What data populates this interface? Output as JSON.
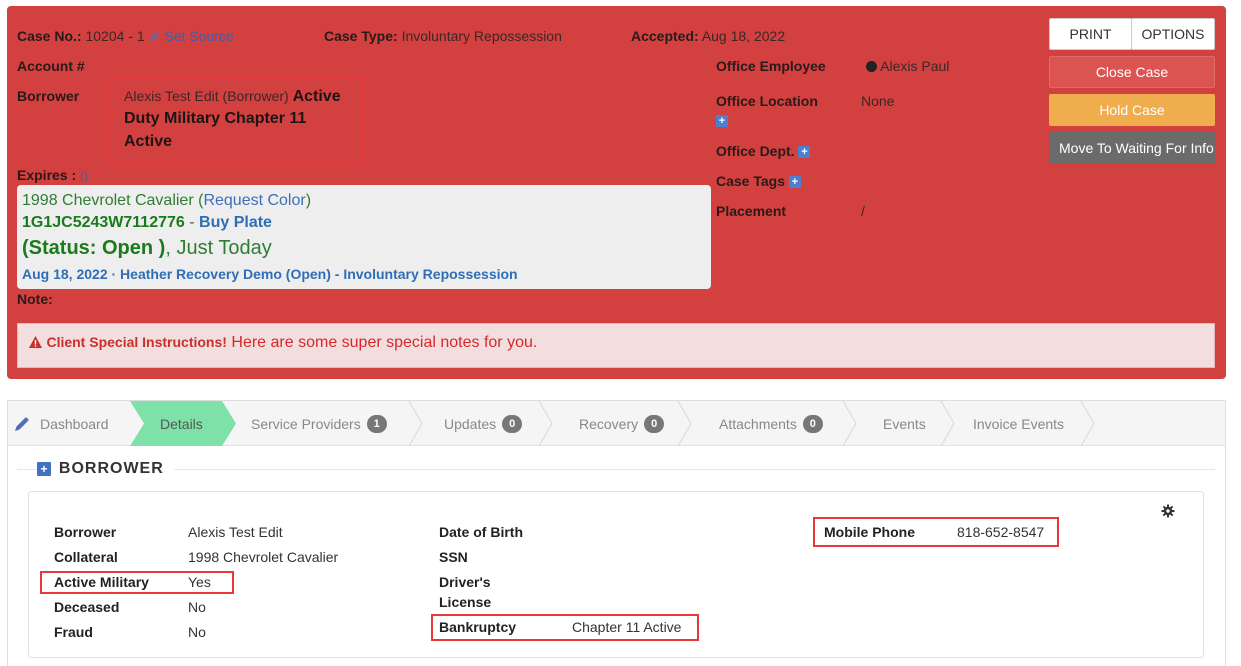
{
  "header": {
    "case_no_label": "Case No.:",
    "case_no_value": "10204 - 1",
    "set_source": "Set Source",
    "case_type_label": "Case Type:",
    "case_type_value": "Involuntary Repossession",
    "accepted_label": "Accepted:",
    "accepted_value": "Aug 18, 2022",
    "account_label": "Account #",
    "borrower_label": "Borrower",
    "borrower_name": "Alexis Test Edit (Borrower)",
    "borrower_status_1": "Active",
    "borrower_status_2": "Duty Military Chapter 11",
    "borrower_status_3": "Active",
    "expires_label": "Expires :",
    "expires_value": "()",
    "note_label": "Note:",
    "office_employee_label": "Office Employee",
    "office_employee_value": "Alexis Paul",
    "office_location_label": "Office Location",
    "office_location_value": "None",
    "office_dept_label": "Office Dept.",
    "case_tags_label": "Case Tags",
    "placement_label": "Placement",
    "placement_value": "/"
  },
  "vehicle": {
    "name": "1998 Chevrolet Cavalier",
    "request_color": "Request Color",
    "vin": "1G1JC5243W7112776",
    "buy_plate": "Buy Plate",
    "status": "(Status: Open )",
    "status_when": ", Just Today",
    "history": "Aug 18, 2022 · Heather Recovery Demo (Open) - Involuntary Repossession"
  },
  "special": {
    "label": "Client Special Instructions!",
    "text": "Here are some super special notes for you."
  },
  "buttons": {
    "print": "PRINT",
    "options": "OPTIONS",
    "close_case": "Close Case",
    "hold_case": "Hold Case",
    "waiting": "Move To Waiting For Info"
  },
  "tabs": [
    {
      "label": "Dashboard"
    },
    {
      "label": "Details"
    },
    {
      "label": "Service Providers",
      "badge": "1"
    },
    {
      "label": "Updates",
      "badge": "0"
    },
    {
      "label": "Recovery",
      "badge": "0"
    },
    {
      "label": "Attachments",
      "badge": "0"
    },
    {
      "label": "Events"
    },
    {
      "label": "Invoice Events"
    }
  ],
  "borrower_section": {
    "title": "BORROWER",
    "borrower_label": "Borrower",
    "borrower_value": "Alexis Test Edit",
    "collateral_label": "Collateral",
    "collateral_value": "1998 Chevrolet Cavalier",
    "active_military_label": "Active Military",
    "active_military_value": "Yes",
    "deceased_label": "Deceased",
    "deceased_value": "No",
    "fraud_label": "Fraud",
    "fraud_value": "No",
    "dob_label": "Date of Birth",
    "ssn_label": "SSN",
    "dl_label_1": "Driver's",
    "dl_label_2": "License",
    "bankruptcy_label": "Bankruptcy",
    "bankruptcy_value": "Chapter 11 Active",
    "mobile_label": "Mobile Phone",
    "mobile_value": "818-652-8547"
  },
  "colors": {
    "header_bg": "#d2403f",
    "details_tab": "#7ee2a8",
    "hold": "#f0ad4e",
    "wait": "#6b6b6b",
    "highlight": "#e8383b"
  }
}
